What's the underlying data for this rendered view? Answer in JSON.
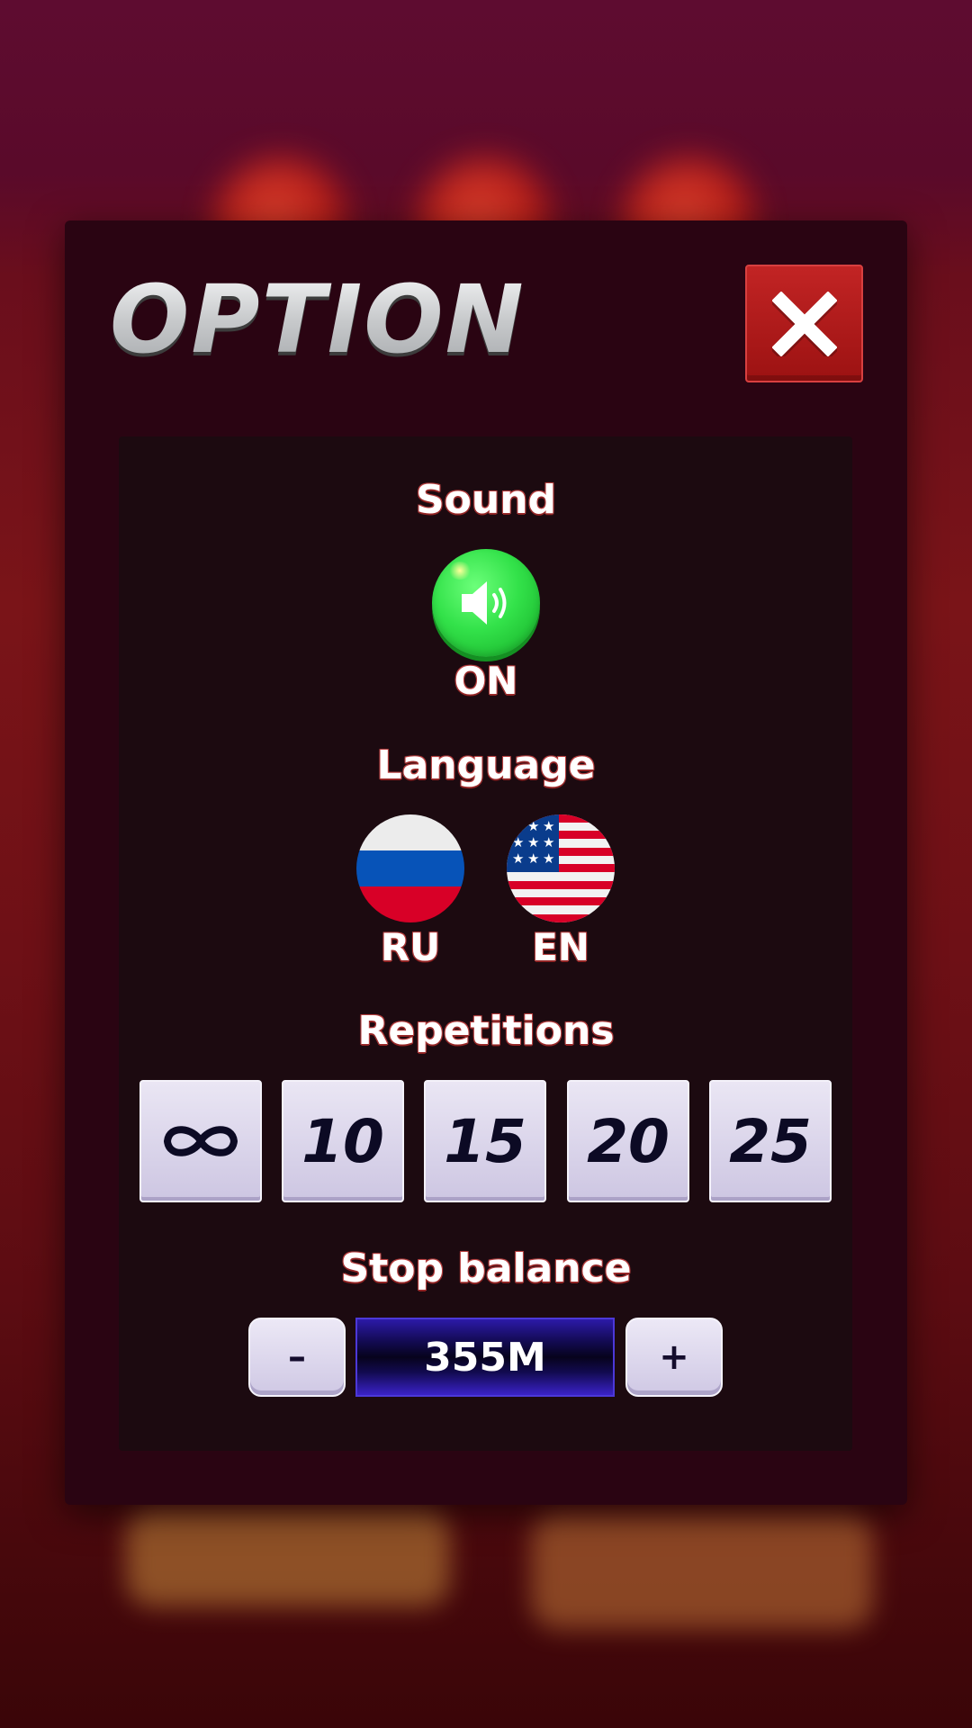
{
  "dialog": {
    "title": "OPTION",
    "close_icon": "close-x-icon"
  },
  "sound": {
    "label": "Sound",
    "state": "ON",
    "icon": "speaker-icon",
    "color": "#33e24a"
  },
  "language": {
    "label": "Language",
    "options": [
      {
        "code": "RU",
        "icon": "russia-flag-icon"
      },
      {
        "code": "EN",
        "icon": "usa-flag-icon"
      }
    ]
  },
  "repetitions": {
    "label": "Repetitions",
    "options": [
      "∞",
      "10",
      "15",
      "20",
      "25"
    ]
  },
  "stop_balance": {
    "label": "Stop balance",
    "decrease": "–",
    "value": "355M",
    "increase": "+"
  },
  "colors": {
    "panel": "#2a0412",
    "inner_panel": "#1c0a10",
    "close_button": "#b01c1c",
    "balance_field": "#120a50"
  }
}
